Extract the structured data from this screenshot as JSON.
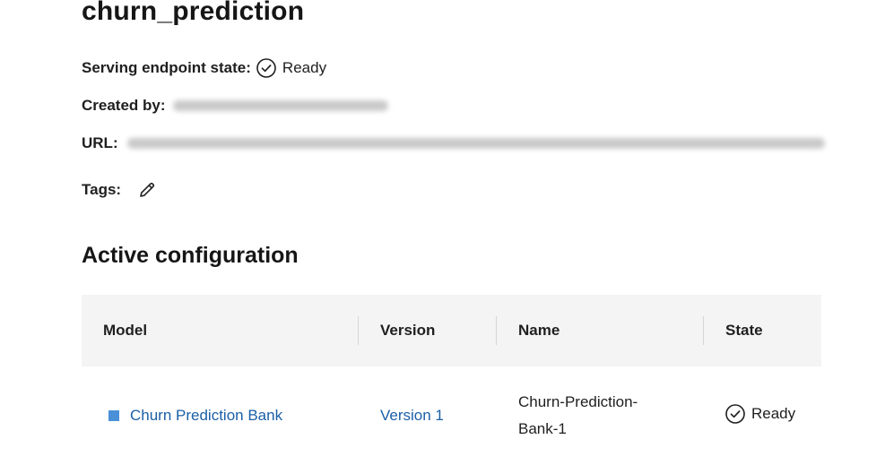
{
  "page": {
    "title": "churn_prediction"
  },
  "details": {
    "state_label": "Serving endpoint state:",
    "state_value": "Ready",
    "created_label": "Created by:",
    "url_label": "URL:",
    "tags_label": "Tags:",
    "edit_icon": "pencil-icon",
    "status_icon": "check-circle-icon"
  },
  "active": {
    "title": "Active configuration",
    "columns": [
      "Model",
      "Version",
      "Name",
      "State"
    ],
    "rows": [
      {
        "model": "Churn Prediction Bank",
        "version": "Version 1",
        "name_line1": "Churn-Prediction-",
        "name_line2": "Bank-1",
        "state": "Ready"
      }
    ]
  },
  "colors": {
    "link": "#1b5fa5",
    "model_square": "#4a90d9",
    "header_bg": "#f4f4f4"
  }
}
